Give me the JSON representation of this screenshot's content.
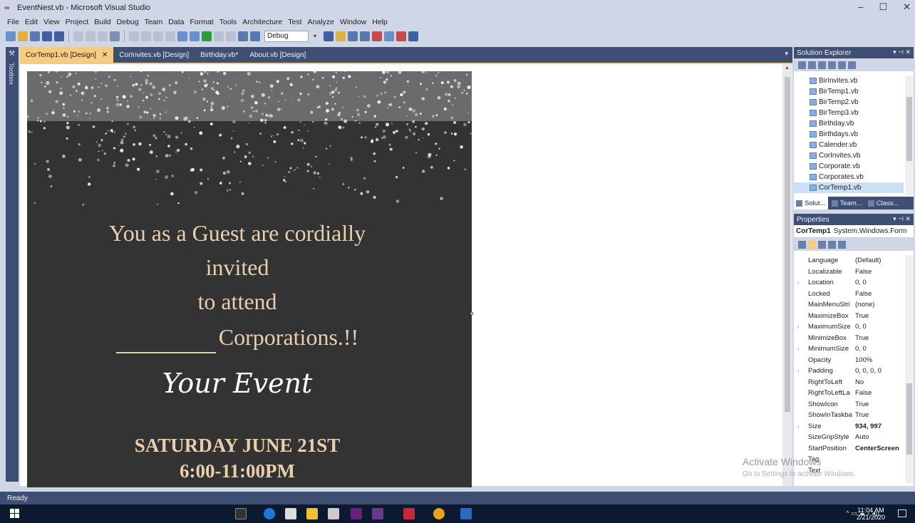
{
  "window": {
    "title": "EventNest.vb - Microsoft Visual Studio",
    "minimize": "–",
    "maximize": "☐",
    "close": "✕"
  },
  "menu": [
    "File",
    "Edit",
    "View",
    "Project",
    "Build",
    "Debug",
    "Team",
    "Data",
    "Format",
    "Tools",
    "Architecture",
    "Test",
    "Analyze",
    "Window",
    "Help"
  ],
  "toolbar": {
    "config": "Debug"
  },
  "toolbox_label": "Toolbox",
  "tabs": [
    {
      "label": "CorTemp1.vb [Design]",
      "active": true
    },
    {
      "label": "CorInvites.vb [Design]",
      "active": false
    },
    {
      "label": "Birthday.vb*",
      "active": false
    },
    {
      "label": "About.vb [Design]",
      "active": false
    }
  ],
  "invitation": {
    "line1": "You as a Guest are cordially",
    "line2": "invited",
    "line3": "to attend",
    "line4": "Corporations.!!",
    "event": "Your Event",
    "date": "SATURDAY JUNE 21ST",
    "time": "6:00-11:00PM"
  },
  "solution_explorer": {
    "title": "Solution Explorer",
    "files": [
      "BirInvites.vb",
      "BirTemp1.vb",
      "BirTemp2.vb",
      "BirTemp3.vb",
      "Birthday.vb",
      "Birthdays.vb",
      "Calender.vb",
      "CorInvites.vb",
      "Corporate.vb",
      "Corporates.vb",
      "CorTemp1.vb"
    ],
    "selected": "CorTemp1.vb",
    "bottom_tabs": [
      "Solut...",
      "Team...",
      "Class..."
    ]
  },
  "properties": {
    "title": "Properties",
    "object_name": "CorTemp1",
    "object_type": "System.Windows.Form",
    "rows": [
      {
        "name": "Language",
        "value": "(Default)",
        "expandable": false,
        "bold": false
      },
      {
        "name": "Localizable",
        "value": "False",
        "expandable": false,
        "bold": false
      },
      {
        "name": "Location",
        "value": "0, 0",
        "expandable": true,
        "bold": false
      },
      {
        "name": "Locked",
        "value": "False",
        "expandable": false,
        "bold": false
      },
      {
        "name": "MainMenuStri",
        "value": "(none)",
        "expandable": false,
        "bold": false
      },
      {
        "name": "MaximizeBox",
        "value": "True",
        "expandable": false,
        "bold": false
      },
      {
        "name": "MaximumSize",
        "value": "0, 0",
        "expandable": true,
        "bold": false
      },
      {
        "name": "MinimizeBox",
        "value": "True",
        "expandable": false,
        "bold": false
      },
      {
        "name": "MinimumSize",
        "value": "0, 0",
        "expandable": true,
        "bold": false
      },
      {
        "name": "Opacity",
        "value": "100%",
        "expandable": false,
        "bold": false
      },
      {
        "name": "Padding",
        "value": "0, 0, 0, 0",
        "expandable": true,
        "bold": false
      },
      {
        "name": "RightToLeft",
        "value": "No",
        "expandable": false,
        "bold": false
      },
      {
        "name": "RightToLeftLa",
        "value": "False",
        "expandable": false,
        "bold": false
      },
      {
        "name": "ShowIcon",
        "value": "True",
        "expandable": false,
        "bold": false
      },
      {
        "name": "ShowInTaskba",
        "value": "True",
        "expandable": false,
        "bold": false
      },
      {
        "name": "Size",
        "value": "934, 997",
        "expandable": true,
        "bold": true
      },
      {
        "name": "SizeGripStyle",
        "value": "Auto",
        "expandable": false,
        "bold": false
      },
      {
        "name": "StartPosition",
        "value": "CenterScreen",
        "expandable": false,
        "bold": true
      },
      {
        "name": "Tag",
        "value": "",
        "expandable": false,
        "bold": false
      },
      {
        "name": "Text",
        "value": "",
        "expandable": false,
        "bold": false
      }
    ]
  },
  "watermark": {
    "line1": "Activate Windows",
    "line2": "Go to Settings to activate Windows."
  },
  "status": "Ready",
  "clock": {
    "time": "11:04 AM",
    "date": "2/21/2020"
  },
  "colors": {
    "vs_blue": "#3e4f73",
    "tab_active": "#f5cc84",
    "form_bg": "#333333",
    "text_gold": "#e8cfae"
  }
}
